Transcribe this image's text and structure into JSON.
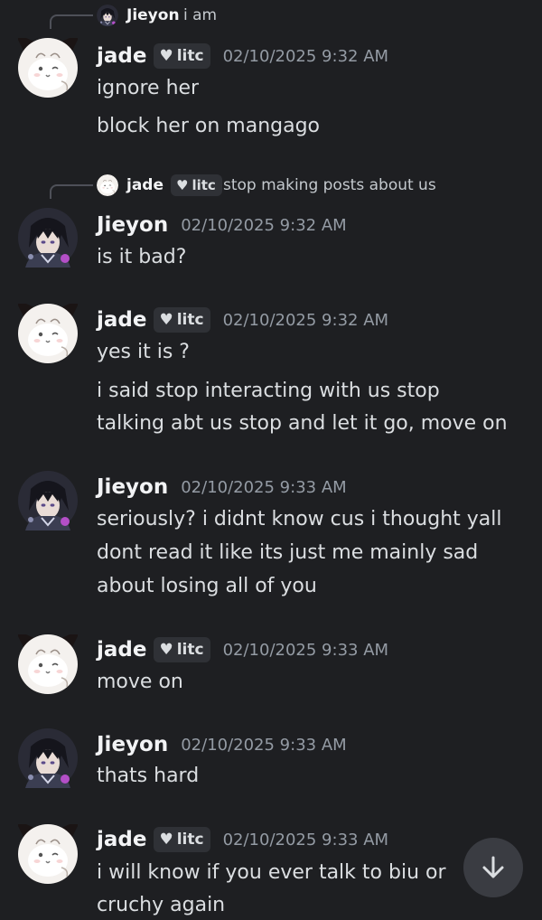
{
  "reply1": {
    "author": "Jieyon",
    "text": "i am"
  },
  "reply2": {
    "author": "jade",
    "tag": "litc",
    "text": "stop making posts about us"
  },
  "messages": [
    {
      "author": "jade",
      "tag": "litc",
      "time": "02/10/2025 9:32 AM",
      "lines": [
        "ignore her",
        "block her on mangago"
      ]
    },
    {
      "author": "Jieyon",
      "time": "02/10/2025 9:32 AM",
      "lines": [
        "is it bad?"
      ]
    },
    {
      "author": "jade",
      "tag": "litc",
      "time": "02/10/2025 9:32 AM",
      "lines": [
        "yes it is ?",
        "i said stop interacting with us stop",
        "talking abt us stop and let it go, move on"
      ]
    },
    {
      "author": "Jieyon",
      "time": "02/10/2025 9:33 AM",
      "lines": [
        "seriously? i didnt know cus i thought yall",
        "dont read it like its just me mainly sad",
        "about losing all of you"
      ]
    },
    {
      "author": "jade",
      "tag": "litc",
      "time": "02/10/2025 9:33 AM",
      "lines": [
        "move on"
      ]
    },
    {
      "author": "Jieyon",
      "time": "02/10/2025 9:33 AM",
      "lines": [
        "thats hard"
      ]
    },
    {
      "author": "jade",
      "tag": "litc",
      "time": "02/10/2025 9:33 AM",
      "lines": [
        "i will know if you ever talk to biu or",
        "cruchy again"
      ]
    }
  ],
  "icons": {
    "scroll": "arrow-down-icon",
    "tag_heart": "heart-icon"
  }
}
